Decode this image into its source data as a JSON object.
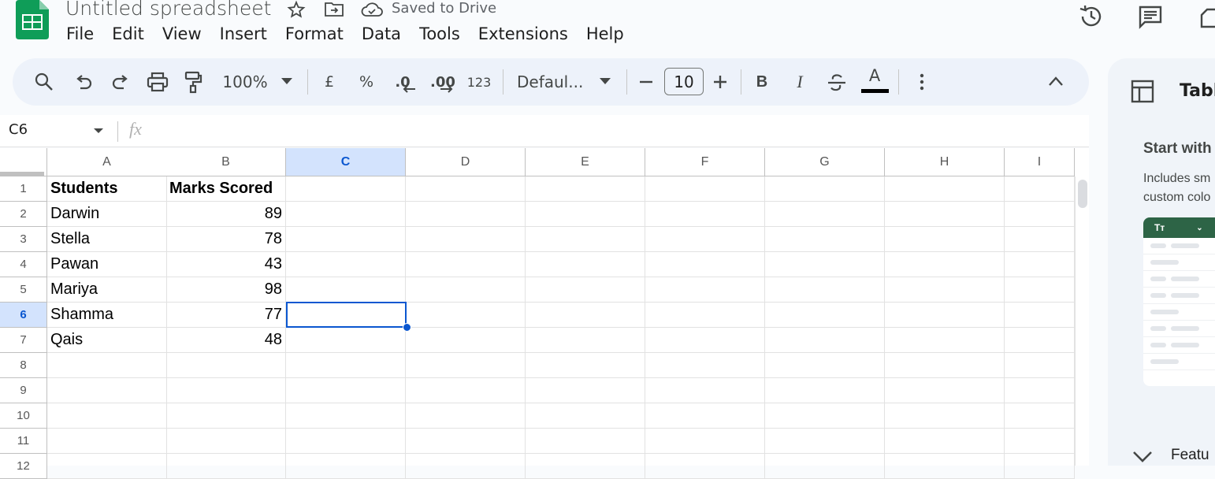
{
  "doc": {
    "title": "Untitled spreadsheet",
    "saved_status": "Saved to Drive"
  },
  "menu": [
    "File",
    "Edit",
    "View",
    "Insert",
    "Format",
    "Data",
    "Tools",
    "Extensions",
    "Help"
  ],
  "toolbar": {
    "zoom": "100%",
    "currency": "£",
    "percent": "%",
    "decrease_decimal": ".0",
    "increase_decimal": ".00",
    "number_format": "123",
    "font": "Defaul...",
    "font_size": "10",
    "bold": "B",
    "italic": "I",
    "text_color": "A"
  },
  "name_box": {
    "value": "C6"
  },
  "formula_bar": {
    "label": "fx",
    "value": ""
  },
  "sheet": {
    "columns": [
      "A",
      "B",
      "C",
      "D",
      "E",
      "F",
      "G",
      "H",
      "I"
    ],
    "active_column": "C",
    "rows": [
      "1",
      "2",
      "3",
      "4",
      "5",
      "6",
      "7",
      "8",
      "9",
      "10",
      "11",
      "12"
    ],
    "active_row": "6",
    "selected_cell": "C6",
    "data": [
      [
        "Students",
        "Marks Scored"
      ],
      [
        "Darwin",
        "89"
      ],
      [
        "Stella",
        "78"
      ],
      [
        "Pawan",
        "43"
      ],
      [
        "Mariya",
        "98"
      ],
      [
        "Shamma",
        "77"
      ],
      [
        "Qais",
        "48"
      ]
    ]
  },
  "side_panel": {
    "title": "Tabl",
    "heading": "Start with",
    "desc_line1": "Includes sm",
    "desc_line2": "custom colo",
    "preview_header": "Tт",
    "features_label": "Featu"
  },
  "colors": {
    "accent": "#0b57d0",
    "sheets_green": "#0f9d58",
    "toolbar_bg": "#edf2fa",
    "active_header": "#d3e3fd"
  }
}
